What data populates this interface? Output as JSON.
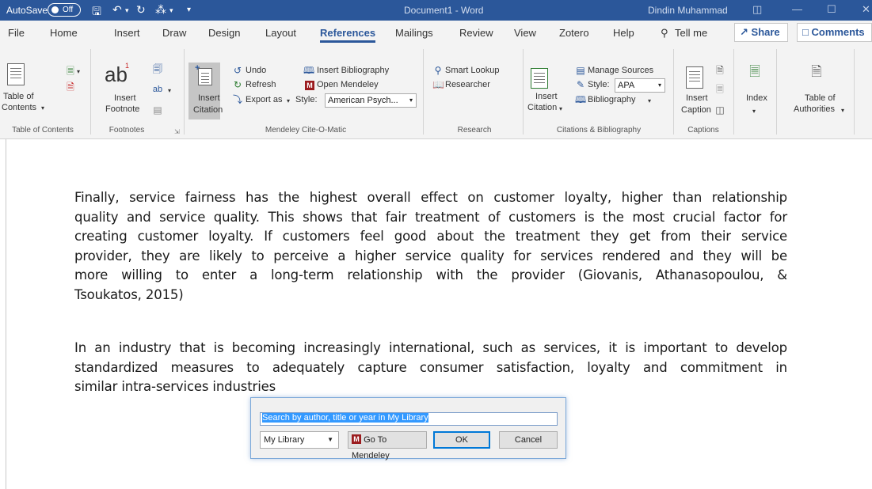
{
  "title_bar": {
    "autosave_label": "AutoSave",
    "autosave_state": "Off",
    "document_title": "Document1  -  Word",
    "user_name": "Dindin Muhammad"
  },
  "tabs": [
    {
      "label": "File"
    },
    {
      "label": "Home"
    },
    {
      "label": "Insert"
    },
    {
      "label": "Draw"
    },
    {
      "label": "Design"
    },
    {
      "label": "Layout"
    },
    {
      "label": "References",
      "active": true
    },
    {
      "label": "Mailings"
    },
    {
      "label": "Review"
    },
    {
      "label": "View"
    },
    {
      "label": "Zotero"
    },
    {
      "label": "Help"
    }
  ],
  "tell_me": "Tell me",
  "share_label": "Share",
  "comments_label": "Comments",
  "ribbon": {
    "toc": {
      "button_line1": "Table of",
      "button_line2": "Contents",
      "group_label": "Table of Contents"
    },
    "footnotes": {
      "insert_line1": "Insert",
      "insert_line2": "Footnote",
      "group_label": "Footnotes"
    },
    "mendeley": {
      "insert_citation_line1": "Insert",
      "insert_citation_line2": "Citation",
      "undo": "Undo",
      "refresh": "Refresh",
      "export_as": "Export as",
      "insert_bibliography": "Insert Bibliography",
      "open_mendeley": "Open Mendeley",
      "style_label": "Style:",
      "style_value": "American Psych...",
      "group_label": "Mendeley Cite-O-Matic"
    },
    "research": {
      "smart_lookup": "Smart Lookup",
      "researcher": "Researcher",
      "group_label": "Research"
    },
    "citations": {
      "insert_citation_line1": "Insert",
      "insert_citation_line2": "Citation",
      "manage_sources": "Manage Sources",
      "style_label": "Style:",
      "style_value": "APA",
      "bibliography": "Bibliography",
      "group_label": "Citations & Bibliography"
    },
    "captions": {
      "insert_line1": "Insert",
      "insert_line2": "Caption",
      "group_label": "Captions"
    },
    "index": {
      "label": "Index"
    },
    "authorities": {
      "line1": "Table of",
      "line2": "Authorities"
    }
  },
  "document": {
    "paragraph1_lines": [
      "Finally, service fairness has the highest overall effect on customer loyalty, higher than relationship",
      "quality and service quality. This shows that fair treatment of customers is the most crucial factor for",
      "creating customer loyalty. If customers feel good about the treatment they get from their service",
      "provider, they are likely to perceive a higher service quality for services rendered and they will be",
      "more willing to enter a long-term relationship with the provider (Giovanis, Athanasopoulou, &",
      "Tsoukatos, 2015)"
    ],
    "paragraph2_lines": [
      "In an industry that is becoming increasingly international, such as services, it is important to develop",
      "standardized measures to adequately capture consumer satisfaction, loyalty and commitment in",
      "similar intra-services industries"
    ]
  },
  "dialog": {
    "search_value": "Search by author, title or year in My Library",
    "library_value": "My Library",
    "go_to_mendeley": "Go To Mendeley",
    "ok": "OK",
    "cancel": "Cancel"
  },
  "colors": {
    "word_blue": "#2b579a",
    "mendeley_red": "#9b1c1f",
    "selection_blue": "#3399ff"
  }
}
